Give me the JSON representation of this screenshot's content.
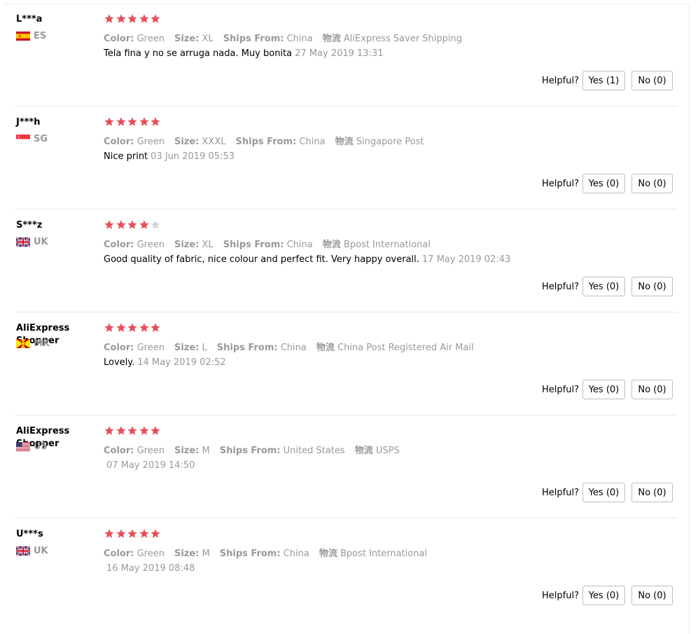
{
  "helpful_label": "Helpful?",
  "colors": {
    "star_filled": "#e94d57",
    "star_empty": "#d6d6d6",
    "meta_gray": "#999999"
  },
  "reviews": [
    {
      "name": "L***a",
      "country": "ES",
      "flag": "es",
      "rating": 5,
      "attrs": [
        {
          "key": "Color:",
          "value": "Green"
        },
        {
          "key": "Size:",
          "value": "XL"
        },
        {
          "key": "Ships From:",
          "value": "China"
        },
        {
          "key": "物流",
          "value": "AliExpress Saver Shipping"
        }
      ],
      "text": "Tela fina y no se arruga nada. Muy bonita",
      "date": "27 May 2019 13:31",
      "yes": "Yes (1)",
      "no": "No (0)"
    },
    {
      "name": "J***h",
      "country": "SG",
      "flag": "sg",
      "rating": 5,
      "attrs": [
        {
          "key": "Color:",
          "value": "Green"
        },
        {
          "key": "Size:",
          "value": "XXXL"
        },
        {
          "key": "Ships From:",
          "value": "China"
        },
        {
          "key": "物流",
          "value": "Singapore Post"
        }
      ],
      "text": "Nice print",
      "date": "03 Jun 2019 05:53",
      "yes": "Yes (0)",
      "no": "No (0)"
    },
    {
      "name": "S***z",
      "country": "UK",
      "flag": "uk",
      "rating": 4,
      "attrs": [
        {
          "key": "Color:",
          "value": "Green"
        },
        {
          "key": "Size:",
          "value": "XL"
        },
        {
          "key": "Ships From:",
          "value": "China"
        },
        {
          "key": "物流",
          "value": "Bpost International"
        }
      ],
      "text": "Good quality of fabric, nice colour and perfect fit. Very happy overall.",
      "date": "17 May 2019 02:43",
      "yes": "Yes (0)",
      "no": "No (0)"
    },
    {
      "name": "AliExpress Shopper",
      "country": "MK",
      "flag": "mk",
      "rating": 5,
      "attrs": [
        {
          "key": "Color:",
          "value": "Green"
        },
        {
          "key": "Size:",
          "value": "L"
        },
        {
          "key": "Ships From:",
          "value": "China"
        },
        {
          "key": "物流",
          "value": "China Post Registered Air Mail"
        }
      ],
      "text": "Lovely.",
      "date": "14 May 2019 02:52",
      "yes": "Yes (0)",
      "no": "No (0)"
    },
    {
      "name": "AliExpress Shopper",
      "country": "US",
      "flag": "us",
      "rating": 5,
      "attrs": [
        {
          "key": "Color:",
          "value": "Green"
        },
        {
          "key": "Size:",
          "value": "M"
        },
        {
          "key": "Ships From:",
          "value": "United States"
        },
        {
          "key": "物流",
          "value": "USPS"
        }
      ],
      "text": "",
      "date": "07 May 2019 14:50",
      "yes": "Yes (0)",
      "no": "No (0)"
    },
    {
      "name": "U***s",
      "country": "UK",
      "flag": "uk",
      "rating": 5,
      "attrs": [
        {
          "key": "Color:",
          "value": "Green"
        },
        {
          "key": "Size:",
          "value": "M"
        },
        {
          "key": "Ships From:",
          "value": "China"
        },
        {
          "key": "物流",
          "value": "Bpost International"
        }
      ],
      "text": "",
      "date": "16 May 2019 08:48",
      "yes": "Yes (0)",
      "no": "No (0)"
    }
  ]
}
